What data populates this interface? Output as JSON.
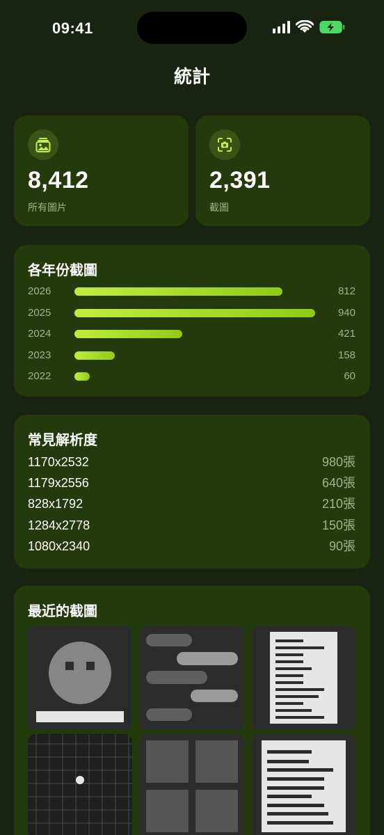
{
  "status_bar": {
    "time": "09:41"
  },
  "page": {
    "title": "統計"
  },
  "stats": [
    {
      "value": "8,412",
      "label": "所有圖片",
      "icon": "photo-stack-icon"
    },
    {
      "value": "2,391",
      "label": "截圖",
      "icon": "screenshot-icon"
    }
  ],
  "years_section": {
    "title": "各年份截圖",
    "rows": [
      {
        "year": "2026",
        "count": "812",
        "value": 812
      },
      {
        "year": "2025",
        "count": "940",
        "value": 940
      },
      {
        "year": "2024",
        "count": "421",
        "value": 421
      },
      {
        "year": "2023",
        "count": "158",
        "value": 158
      },
      {
        "year": "2022",
        "count": "60",
        "value": 60
      }
    ]
  },
  "resolutions_section": {
    "title": "常見解析度",
    "rows": [
      {
        "resolution": "1170x2532",
        "count": "980張"
      },
      {
        "resolution": "1179x2556",
        "count": "640張"
      },
      {
        "resolution": "828x1792",
        "count": "210張"
      },
      {
        "resolution": "1284x2778",
        "count": "150張"
      },
      {
        "resolution": "1080x2340",
        "count": "90張"
      }
    ]
  },
  "recent_section": {
    "title": "最近的截圖",
    "thumbnails": [
      "face-screenshot",
      "chat-screenshot",
      "document-screenshot",
      "grid-screenshot",
      "tiles-screenshot",
      "text-screenshot"
    ]
  },
  "colors": {
    "accent": "#bfee3c",
    "card": "#233a0c",
    "background": "#182310"
  }
}
